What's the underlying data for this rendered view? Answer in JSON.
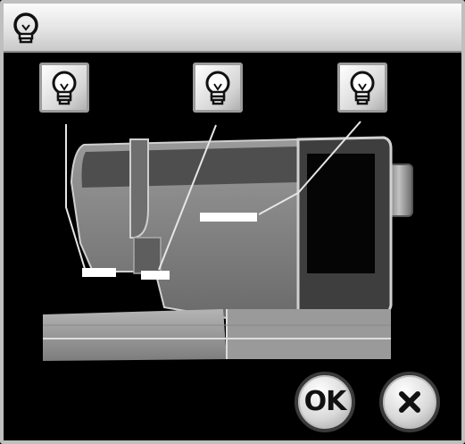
{
  "title_bar": {
    "icon": "lightbulb-icon"
  },
  "light_buttons": [
    {
      "name": "light-left",
      "icon": "lightbulb-icon",
      "state": "on"
    },
    {
      "name": "light-center",
      "icon": "lightbulb-icon",
      "state": "on"
    },
    {
      "name": "light-right",
      "icon": "lightbulb-icon",
      "state": "on"
    }
  ],
  "illustration": {
    "subject": "sewing-machine",
    "light_indicators": 3
  },
  "actions": {
    "ok_label": "OK",
    "cancel_icon": "close-icon"
  },
  "colors": {
    "background": "#000000",
    "frame": "#bfbfbf",
    "indicator": "#ffffff"
  }
}
